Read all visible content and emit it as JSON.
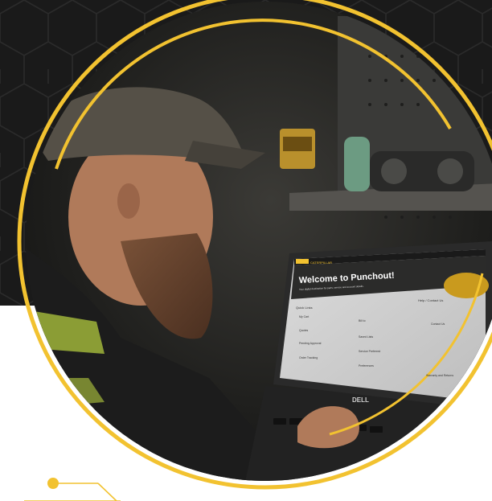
{
  "laptop_screen": {
    "brand_logo": "CATERPILLAR",
    "hero_title": "Welcome to Punchout!",
    "hero_subtitle": "Your digital destination for parts, service and account details.",
    "quick_links_heading": "Quick Links",
    "help_heading": "Help / Contact Us",
    "quick_links_left": [
      "My Cart",
      "Quotes",
      "Pending Approval",
      "Order Tracking"
    ],
    "quick_links_mid": [
      "Bill to",
      "Saved Lists",
      "Service Preferred",
      "Preferences"
    ],
    "help_items": [
      "Contact Us",
      "Warranty and Returns"
    ]
  },
  "laptop_brand": "DELL",
  "colors": {
    "accent_gold": "#f2c230",
    "hex_dark": "#1b1b1b",
    "hex_line": "#2a2a2a"
  }
}
